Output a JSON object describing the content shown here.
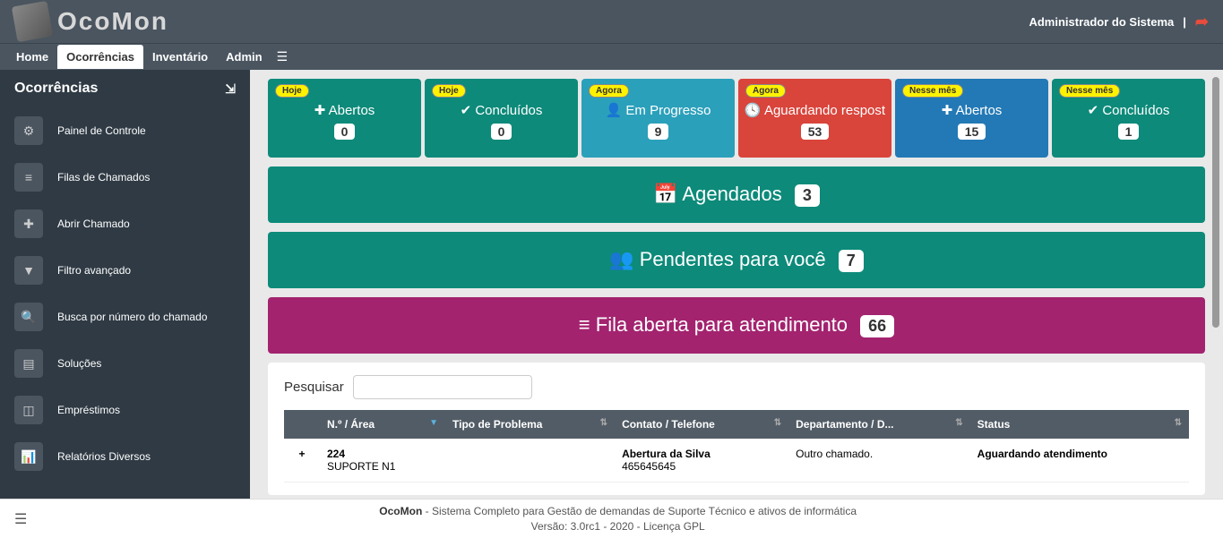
{
  "header": {
    "logo_text": "OcoMon",
    "user_label": "Administrador do Sistema"
  },
  "nav": {
    "items": [
      "Home",
      "Ocorrências",
      "Inventário",
      "Admin"
    ],
    "active_index": 1
  },
  "sidebar": {
    "title": "Ocorrências",
    "items": [
      {
        "icon": "dashboard-icon",
        "glyph": "⚙",
        "label": "Painel de Controle"
      },
      {
        "icon": "list-icon",
        "glyph": "≡",
        "label": "Filas de Chamados"
      },
      {
        "icon": "plus-icon",
        "glyph": "✚",
        "label": "Abrir Chamado"
      },
      {
        "icon": "filter-icon",
        "glyph": "▼",
        "label": "Filtro avançado"
      },
      {
        "icon": "search-icon",
        "glyph": "🔍",
        "label": "Busca por número do chamado"
      },
      {
        "icon": "solutions-icon",
        "glyph": "▤",
        "label": "Soluções"
      },
      {
        "icon": "loans-icon",
        "glyph": "◫",
        "label": "Empréstimos"
      },
      {
        "icon": "reports-icon",
        "glyph": "📊",
        "label": "Relatórios Diversos"
      }
    ]
  },
  "stats": [
    {
      "tag": "Hoje",
      "icon": "✚",
      "title": "Abertos",
      "value": "0",
      "color": "card-green"
    },
    {
      "tag": "Hoje",
      "icon": "✔",
      "title": "Concluídos",
      "value": "0",
      "color": "card-green"
    },
    {
      "tag": "Agora",
      "icon": "👤",
      "title": "Em Progresso",
      "value": "9",
      "color": "card-teal"
    },
    {
      "tag": "Agora",
      "icon": "🕓",
      "title": "Aguardando respost",
      "value": "53",
      "color": "card-red"
    },
    {
      "tag": "Nesse mês",
      "icon": "✚",
      "title": "Abertos",
      "value": "15",
      "color": "card-blue"
    },
    {
      "tag": "Nesse mês",
      "icon": "✔",
      "title": "Concluídos",
      "value": "1",
      "color": "card-green"
    }
  ],
  "banners": [
    {
      "icon": "📅",
      "label": "Agendados",
      "count": "3",
      "color": "banner-teal"
    },
    {
      "icon": "👥",
      "label": "Pendentes para você",
      "count": "7",
      "color": "banner-teal"
    },
    {
      "icon": "≡",
      "label": "Fila aberta para atendimento",
      "count": "66",
      "color": "banner-purple"
    }
  ],
  "table": {
    "search_label": "Pesquisar",
    "search_value": "",
    "columns": [
      "",
      "N.º / Área",
      "Tipo de Problema",
      "Contato / Telefone",
      "Departamento / D...",
      "Status"
    ],
    "rows": [
      {
        "expand": "+",
        "num": "224",
        "area": "SUPORTE N1",
        "tipo": "",
        "contato_nome": "Abertura da Silva",
        "contato_tel": "465645645",
        "departamento": "Outro chamado.",
        "status": "Aguardando atendimento"
      }
    ]
  },
  "footer": {
    "product": "OcoMon",
    "line1": "Sistema Completo para Gestão de demandas de Suporte Técnico e ativos de informática",
    "line2": "Versão: 3.0rc1 - 2020 - Licença GPL"
  }
}
